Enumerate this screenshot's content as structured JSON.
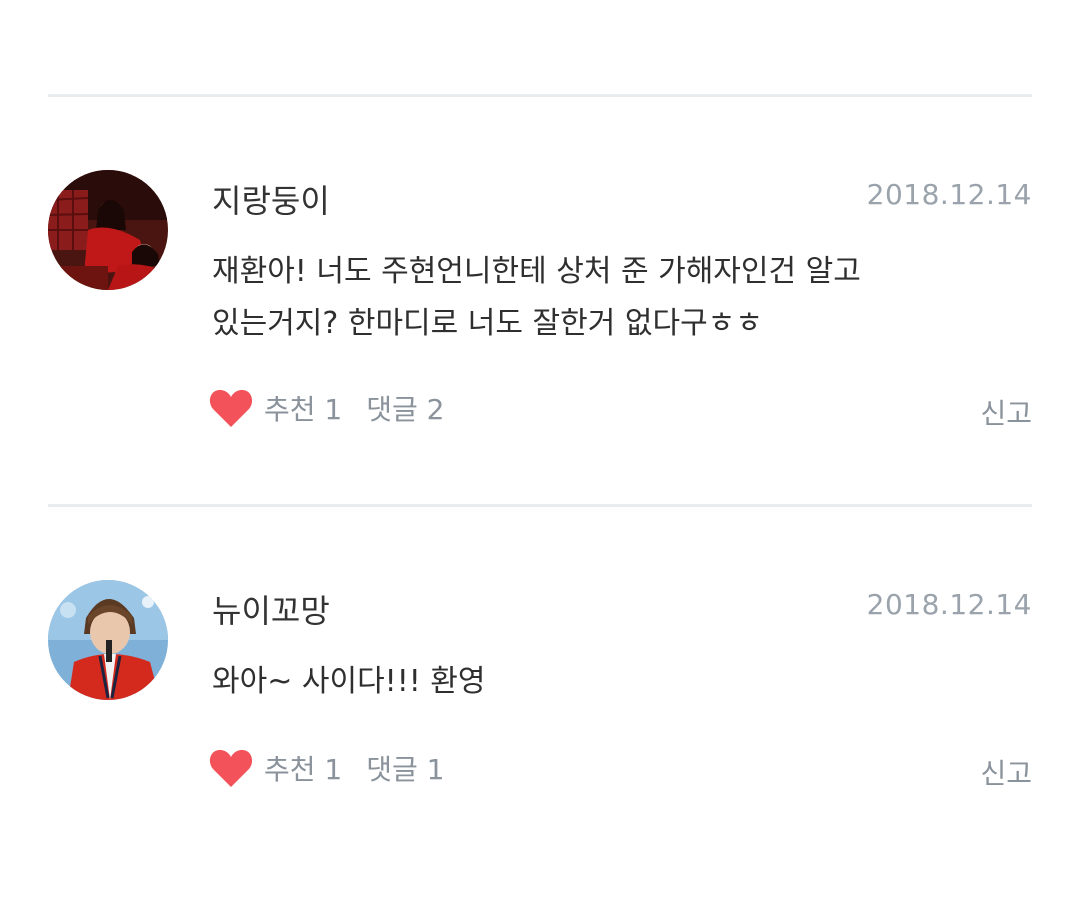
{
  "comments": [
    {
      "author": "지랑둥이",
      "date": "2018.12.14",
      "lines": [
        "재환아! 너도 주현언니한테 상처 준 가해자인건 알고",
        "있는거지? 한마디로 너도 잘한거 없다구ㅎㅎ"
      ],
      "like_label": "추천 1",
      "reply_label": "댓글 2",
      "report_label": "신고"
    },
    {
      "author": "뉴이꼬망",
      "date": "2018.12.14",
      "lines": [
        "와아~ 사이다!!! 환영"
      ],
      "like_label": "추천 1",
      "reply_label": "댓글 1",
      "report_label": "신고"
    }
  ],
  "colors": {
    "heart": "#f4525a",
    "divider": "#e9ecee",
    "meta": "#9aa3ab"
  },
  "icons": {
    "like": "heart-icon",
    "avatar": "avatar"
  }
}
